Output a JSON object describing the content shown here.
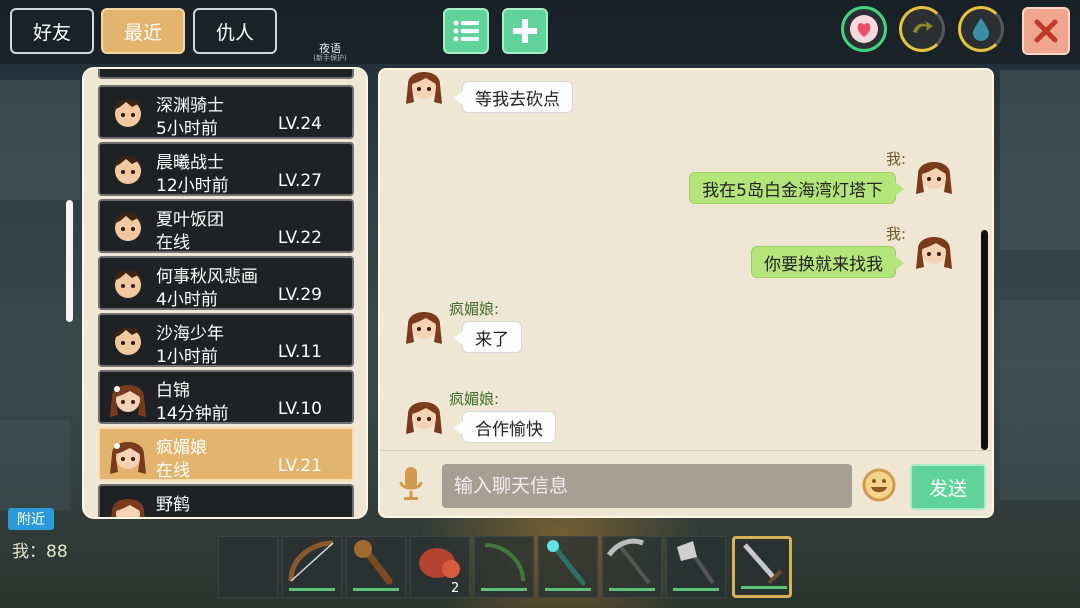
{
  "tabs": {
    "friends": "好友",
    "recent": "最近",
    "enemies": "仇人"
  },
  "night_label": "夜语",
  "night_sublabel": "(新手保护)",
  "icons": {
    "list": "list-icon",
    "add": "plus-icon",
    "heart": "heart-icon",
    "stamina": "stamina-icon",
    "water": "water-drop-icon",
    "close": "close-icon",
    "mic": "microphone-icon",
    "emoji": "emoji-icon"
  },
  "friends": [
    {
      "name": "深渊骑士",
      "status": "5小时前",
      "level": "LV.24",
      "avatar": "boy"
    },
    {
      "name": "晨曦战士",
      "status": "12小时前",
      "level": "LV.27",
      "avatar": "boy"
    },
    {
      "name": "夏叶饭团",
      "status": "在线",
      "level": "LV.22",
      "avatar": "boy"
    },
    {
      "name": "何事秋风悲画",
      "status": "4小时前",
      "level": "LV.29",
      "avatar": "boy"
    },
    {
      "name": "沙海少年",
      "status": "1小时前",
      "level": "LV.11",
      "avatar": "boy"
    },
    {
      "name": "白锦",
      "status": "14分钟前",
      "level": "LV.10",
      "avatar": "girl"
    },
    {
      "name": "疯媚娘",
      "status": "在线",
      "level": "LV.21",
      "avatar": "girl",
      "selected": true
    },
    {
      "name": "野鹤",
      "status": "",
      "level": "",
      "avatar": "girl"
    }
  ],
  "chat": {
    "me_label": "我:",
    "messages": [
      {
        "from": "them",
        "sender": "",
        "text": "等我去砍点"
      },
      {
        "from": "me",
        "sender": "我:",
        "text": "我在5岛白金海湾灯塔下"
      },
      {
        "from": "me",
        "sender": "我:",
        "text": "你要换就来找我"
      },
      {
        "from": "them",
        "sender": "疯媚娘:",
        "text": "来了"
      },
      {
        "from": "them",
        "sender": "疯媚娘:",
        "text": "合作愉快"
      }
    ],
    "input_placeholder": "输入聊天信息",
    "input_value": "",
    "send_label": "发送"
  },
  "nearby_label": "附近",
  "me_status": "我：88",
  "hotbar": {
    "items": [
      "empty",
      "bow-icon",
      "torch-icon",
      "meat-icon",
      "fishing-rod-icon",
      "magic-staff-icon",
      "pickaxe-icon",
      "axe-icon",
      "sword-icon"
    ],
    "meat_count": "2",
    "selected_index": 8
  },
  "colors": {
    "accent_orange": "#e3b46e",
    "accent_green": "#5fd39a",
    "bubble_green": "#b4e57a",
    "close_red": "#f0a58f"
  }
}
